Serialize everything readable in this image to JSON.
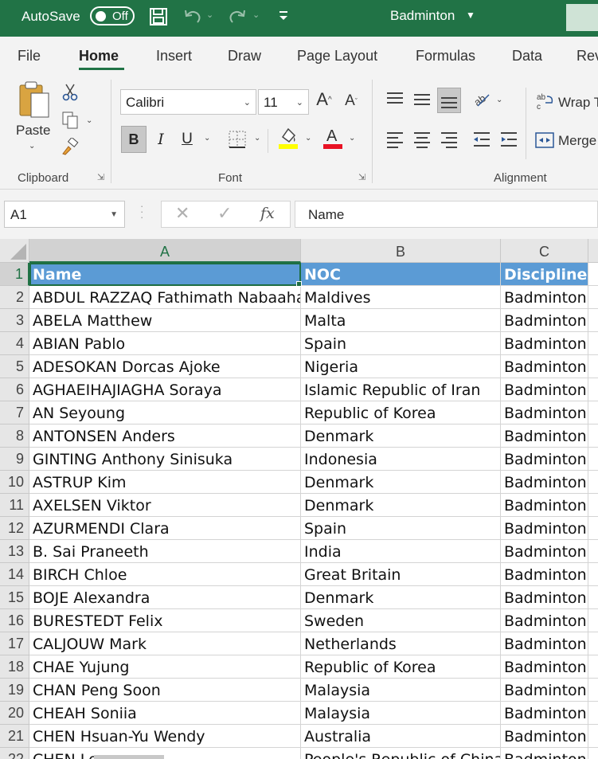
{
  "titlebar": {
    "autosave_label": "AutoSave",
    "autosave_state": "Off",
    "document_title": "Badminton"
  },
  "tabs": [
    "File",
    "Home",
    "Insert",
    "Draw",
    "Page Layout",
    "Formulas",
    "Data",
    "Rev"
  ],
  "ribbon": {
    "clipboard": {
      "paste_label": "Paste",
      "group_label": "Clipboard"
    },
    "font": {
      "font_name": "Calibri",
      "font_size": "11",
      "bold": "B",
      "italic": "I",
      "underline": "U",
      "group_label": "Font",
      "font_color_letter": "A",
      "highlight_color": "#ffff00",
      "font_color": "#e81123"
    },
    "alignment": {
      "wrap_label": "Wrap T",
      "merge_label": "Merge",
      "group_label": "Alignment"
    }
  },
  "formula_bar": {
    "name_box": "A1",
    "fx": "fx",
    "content": "Name"
  },
  "sheet": {
    "columns": [
      "A",
      "B",
      "C"
    ],
    "rows": [
      {
        "num": "1",
        "cells": [
          "Name",
          "NOC",
          "Discipline"
        ]
      },
      {
        "num": "2",
        "cells": [
          "ABDUL RAZZAQ Fathimath Nabaaha",
          "Maldives",
          "Badminton"
        ]
      },
      {
        "num": "3",
        "cells": [
          "ABELA Matthew",
          "Malta",
          "Badminton"
        ]
      },
      {
        "num": "4",
        "cells": [
          "ABIAN Pablo",
          "Spain",
          "Badminton"
        ]
      },
      {
        "num": "5",
        "cells": [
          "ADESOKAN Dorcas Ajoke",
          "Nigeria",
          "Badminton"
        ]
      },
      {
        "num": "6",
        "cells": [
          "AGHAEIHAJIAGHA Soraya",
          "Islamic Republic of Iran",
          "Badminton"
        ]
      },
      {
        "num": "7",
        "cells": [
          "AN Seyoung",
          "Republic of Korea",
          "Badminton"
        ]
      },
      {
        "num": "8",
        "cells": [
          "ANTONSEN Anders",
          "Denmark",
          "Badminton"
        ]
      },
      {
        "num": "9",
        "cells": [
          "GINTING Anthony Sinisuka",
          "Indonesia",
          "Badminton"
        ]
      },
      {
        "num": "10",
        "cells": [
          "ASTRUP Kim",
          "Denmark",
          "Badminton"
        ]
      },
      {
        "num": "11",
        "cells": [
          "AXELSEN Viktor",
          "Denmark",
          "Badminton"
        ]
      },
      {
        "num": "12",
        "cells": [
          "AZURMENDI Clara",
          "Spain",
          "Badminton"
        ]
      },
      {
        "num": "13",
        "cells": [
          "B. Sai Praneeth",
          "India",
          "Badminton"
        ]
      },
      {
        "num": "14",
        "cells": [
          "BIRCH Chloe",
          "Great Britain",
          "Badminton"
        ]
      },
      {
        "num": "15",
        "cells": [
          "BOJE Alexandra",
          "Denmark",
          "Badminton"
        ]
      },
      {
        "num": "16",
        "cells": [
          "BURESTEDT Felix",
          "Sweden",
          "Badminton"
        ]
      },
      {
        "num": "17",
        "cells": [
          "CALJOUW Mark",
          "Netherlands",
          "Badminton"
        ]
      },
      {
        "num": "18",
        "cells": [
          "CHAE Yujung",
          "Republic of Korea",
          "Badminton"
        ]
      },
      {
        "num": "19",
        "cells": [
          "CHAN Peng Soon",
          "Malaysia",
          "Badminton"
        ]
      },
      {
        "num": "20",
        "cells": [
          "CHEAH Soniia",
          "Malaysia",
          "Badminton"
        ]
      },
      {
        "num": "21",
        "cells": [
          "CHEN Hsuan-Yu Wendy",
          "Australia",
          "Badminton"
        ]
      },
      {
        "num": "22",
        "cells": [
          "CHEN Long",
          "People's Republic of China",
          "Badminton"
        ]
      }
    ]
  },
  "colors": {
    "accent": "#217346",
    "table_header": "#5b9bd5"
  }
}
